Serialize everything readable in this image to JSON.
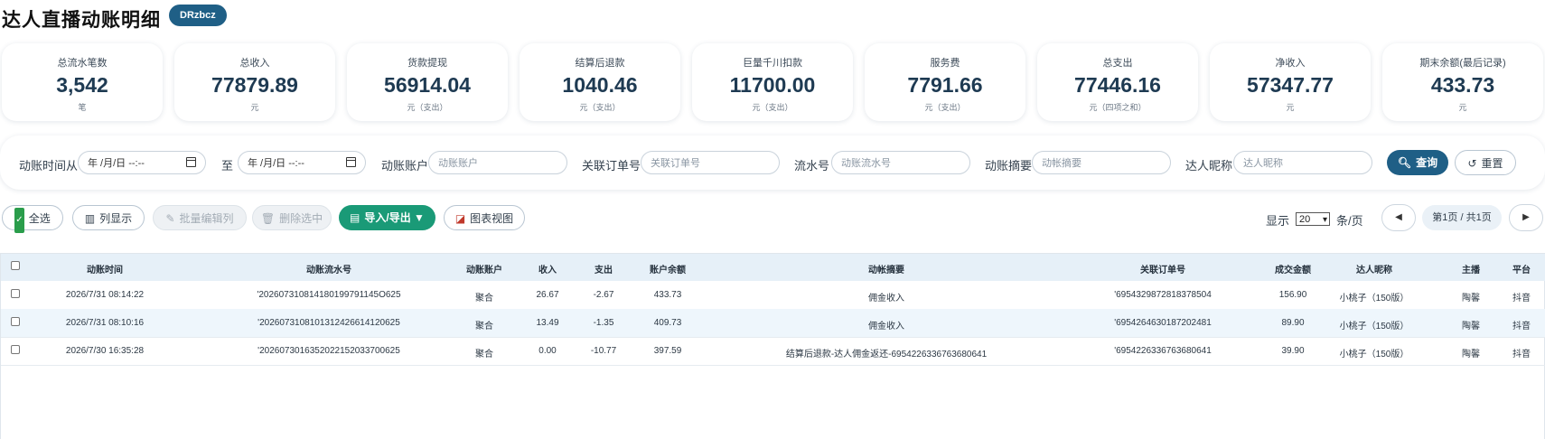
{
  "header": {
    "title": "达人直播动账明细",
    "user": "DRzbcz"
  },
  "stats": [
    {
      "label": "总流水笔数",
      "value": "3,542",
      "unit": "笔"
    },
    {
      "label": "总收入",
      "value": "77879.89",
      "unit": "元"
    },
    {
      "label": "货款提现",
      "value": "56914.04",
      "unit": "元（支出）"
    },
    {
      "label": "结算后退款",
      "value": "1040.46",
      "unit": "元（支出）"
    },
    {
      "label": "巨量千川扣款",
      "value": "11700.00",
      "unit": "元（支出）"
    },
    {
      "label": "服务费",
      "value": "7791.66",
      "unit": "元（支出）"
    },
    {
      "label": "总支出",
      "value": "77446.16",
      "unit": "元（四项之和）"
    },
    {
      "label": "净收入",
      "value": "57347.77",
      "unit": "元"
    },
    {
      "label": "期末余额(最后记录)",
      "value": "433.73",
      "unit": "元"
    }
  ],
  "filters": {
    "time_from_label": "动账时间从",
    "date_placeholder": "年 /月/日 --:--",
    "to_label": "至",
    "account_label": "动账账户",
    "account_placeholder": "动账账户",
    "order_label": "关联订单号",
    "order_placeholder": "关联订单号",
    "serial_label": "流水号",
    "serial_placeholder": "动账流水号",
    "summary_label": "动账摘要",
    "summary_placeholder": "动帐摘要",
    "nick_label": "达人昵称",
    "nick_placeholder": "达人昵称",
    "query_label": "查询",
    "reset_label": "重置"
  },
  "toolbar": {
    "select_all": "全选",
    "columns": "列显示",
    "batch_edit": "批量编辑列",
    "delete_selected": "删除选中",
    "import_export": "导入/导出 ▼",
    "chart_view": "图表视图",
    "show_label": "显示",
    "page_size": "20",
    "per_page": "条/页",
    "page_info": "第1页 / 共1页",
    "prev_icon": "◀",
    "next_icon": "▶"
  },
  "table": {
    "columns": [
      "动账时间",
      "动账流水号",
      "动账账户",
      "收入",
      "支出",
      "账户余额",
      "动帐摘要",
      "关联订单号",
      "成交金额",
      "达人昵称",
      "主播",
      "平台"
    ],
    "rows": [
      [
        "2026/7/31 08:14:22",
        "'202607310814180199791145O625",
        "聚合",
        "26.67",
        "-2.67",
        "433.73",
        "佣金收入",
        "'6954329872818378504",
        "156.90",
        "小桃子（150版）",
        "陶馨",
        "抖音"
      ],
      [
        "2026/7/31 08:10:16",
        "'2026073108101312426614120625",
        "聚合",
        "13.49",
        "-1.35",
        "409.73",
        "佣金收入",
        "'6954264630187202481",
        "89.90",
        "小桃子（150版）",
        "陶馨",
        "抖音"
      ],
      [
        "2026/7/30 16:35:28",
        "'2026073016352022152033700625",
        "聚合",
        "0.00",
        "-10.77",
        "397.59",
        "结算后退款-达人佣金返还-6954226336763680641",
        "'6954226336763680641",
        "39.90",
        "小桃子（150版）",
        "陶馨",
        "抖音"
      ]
    ]
  },
  "colors": {
    "primary": "#1f5f86",
    "green": "#1a9a77",
    "header_bg": "#e6f0f8"
  }
}
